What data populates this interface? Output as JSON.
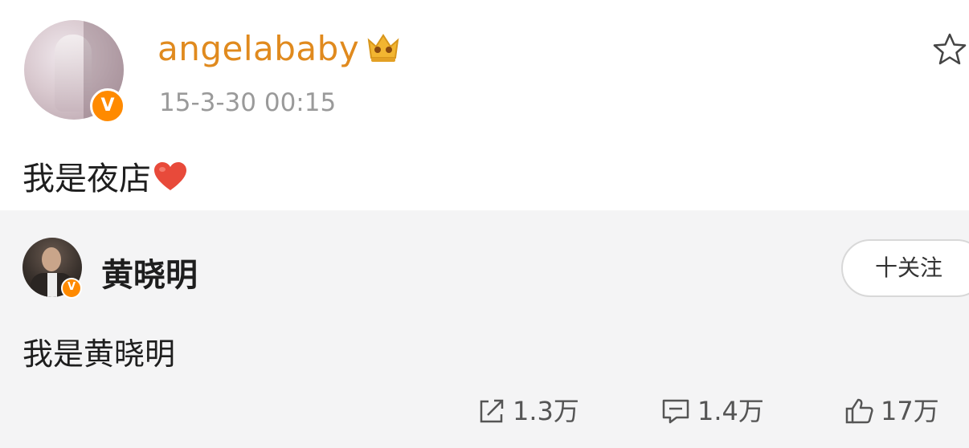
{
  "post": {
    "username": "angelababy",
    "timestamp": "15-3-30 00:15",
    "text": "我是夜店",
    "verified_badge": "V",
    "crown_color": "#f2b531",
    "username_color": "#e08a1e"
  },
  "repost": {
    "username": "黄晓明",
    "verified_badge": "V",
    "follow_label": "十关注",
    "text": "我是黄晓明"
  },
  "actions": {
    "shares": "1.3万",
    "comments": "1.4万",
    "likes": "17万"
  },
  "icons": [
    "crown-icon",
    "star-icon",
    "heart-icon",
    "share-icon",
    "comment-icon",
    "like-icon"
  ]
}
